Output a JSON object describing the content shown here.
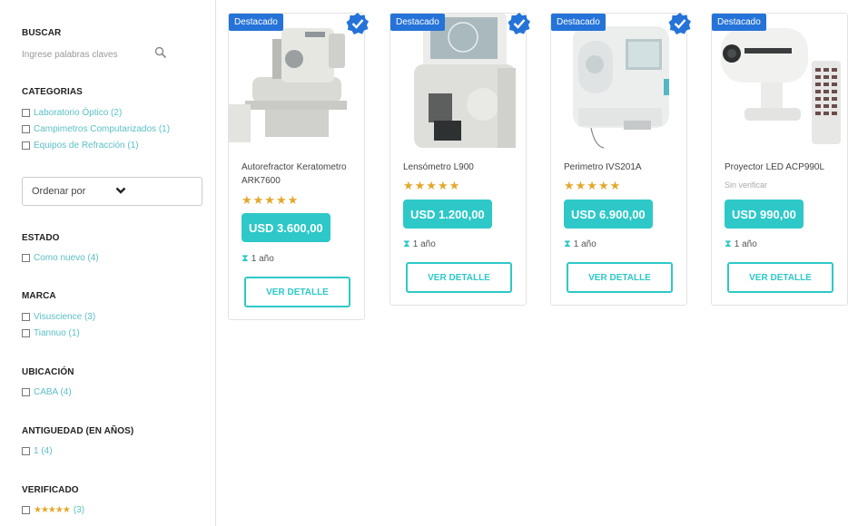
{
  "sidebar": {
    "search": {
      "title": "BUSCAR",
      "placeholder": "Ingrese palabras claves"
    },
    "categories": {
      "title": "CATEGORIAS",
      "items": [
        {
          "label": "Laboratorio Óptico (2)"
        },
        {
          "label": "Campimetros Computarizados (1)"
        },
        {
          "label": "Equipos de Refracción (1)"
        }
      ]
    },
    "sort": {
      "label": "Ordenar por"
    },
    "state": {
      "title": "ESTADO",
      "items": [
        {
          "label": "Como nuevo (4)"
        }
      ]
    },
    "brand": {
      "title": "MARCA",
      "items": [
        {
          "label": "Visuscience (3)"
        },
        {
          "label": "Tiannuo (1)"
        }
      ]
    },
    "location": {
      "title": "UBICACIÓN",
      "items": [
        {
          "label": "CABA (4)"
        }
      ]
    },
    "age": {
      "title": "ANTIGUEDAD (EN AÑOS)",
      "items": [
        {
          "label": "1 (4)"
        }
      ]
    },
    "verified": {
      "title": "VERIFICADO",
      "items": [
        {
          "stars": "★★★★★",
          "count": "(3)"
        }
      ]
    }
  },
  "products": [
    {
      "badge": "Destacado",
      "verified": true,
      "title": "Autorefractor Keratometro ARK7600",
      "stars": "★★★★★",
      "status": "",
      "price": "USD 3.600,00",
      "age": "1 año",
      "button": "VER DETALLE",
      "image": "autorefractor-image"
    },
    {
      "badge": "Destacado",
      "verified": true,
      "title": "Lensómetro L900",
      "stars": "★★★★★",
      "status": "",
      "price": "USD 1.200,00",
      "age": "1 año",
      "button": "VER DETALLE",
      "image": "lensometer-image"
    },
    {
      "badge": "Destacado",
      "verified": true,
      "title": "Perimetro IVS201A",
      "stars": "★★★★★",
      "status": "",
      "price": "USD 6.900,00",
      "age": "1 año",
      "button": "VER DETALLE",
      "image": "perimeter-image"
    },
    {
      "badge": "Destacado",
      "verified": false,
      "title": "Proyector LED ACP990L",
      "stars": "",
      "status": "Sin verificar",
      "price": "USD 990,00",
      "age": "1 año",
      "button": "VER DETALLE",
      "image": "projector-image"
    }
  ],
  "colors": {
    "accent": "#2ec8c8",
    "badge": "#2573d8",
    "star": "#e3a82b",
    "link": "#5bbfc7"
  },
  "icons": {
    "search": "search-icon",
    "sort": "chevron-down-icon",
    "verified": "check-badge-icon",
    "age": "hourglass-icon"
  }
}
